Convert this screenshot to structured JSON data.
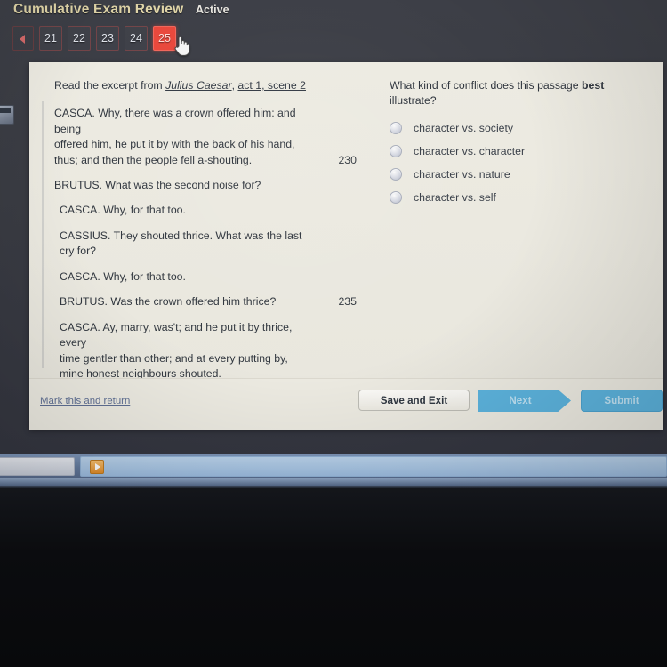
{
  "header": {
    "exam_title": "Cumulative Exam Review",
    "status": "Active"
  },
  "pager": {
    "prev_icon": "chevron-left-icon",
    "pages": [
      "21",
      "22",
      "23",
      "24",
      "25"
    ],
    "active_page": "25"
  },
  "card": {
    "prompt": {
      "lead": "Read the excerpt from ",
      "work": "Julius Caesar",
      "separator": ", ",
      "location": "act 1, scene 2"
    },
    "passage": [
      {
        "lines": [
          "CASCA. Why, there was a crown offered him: and being",
          "offered him, he put it by with the back of his hand,",
          "thus; and then the people fell a-shouting."
        ],
        "lineno": "230"
      },
      {
        "lines": [
          "BRUTUS. What was the second noise for?"
        ],
        "lineno": ""
      },
      {
        "lines": [
          "CASCA. Why, for that too."
        ],
        "lineno": ""
      },
      {
        "lines": [
          "CASSIUS. They shouted thrice. What was the last cry for?"
        ],
        "lineno": ""
      },
      {
        "lines": [
          "CASCA. Why, for that too."
        ],
        "lineno": ""
      },
      {
        "lines": [
          "BRUTUS. Was the crown offered him thrice?"
        ],
        "lineno": "235"
      },
      {
        "lines": [
          "CASCA. Ay, marry, was't; and he put it by thrice, every",
          "time gentler than other; and at every putting by,",
          "mine honest neighbours shouted."
        ],
        "lineno": ""
      }
    ],
    "question": {
      "text_before": "What kind of conflict does this passage ",
      "emphasis": "best",
      "text_after": " illustrate?",
      "options": [
        {
          "label": "character vs. society",
          "selected": false
        },
        {
          "label": "character vs. character",
          "selected": false
        },
        {
          "label": "character vs. nature",
          "selected": false
        },
        {
          "label": "character vs. self",
          "selected": false
        }
      ]
    },
    "footer": {
      "mark_link": "Mark this and return",
      "save_and_exit": "Save and Exit",
      "next": "Next",
      "submit": "Submit"
    }
  },
  "taskbar": {
    "start_label": "",
    "app_icon": "media-play-icon"
  },
  "colors": {
    "accent_blue": "#5cb3dd",
    "active_page_red": "#e9483c",
    "title_gold": "#e0d5a8",
    "card_cream": "#eceae1",
    "link_blue": "#5f6f93"
  }
}
